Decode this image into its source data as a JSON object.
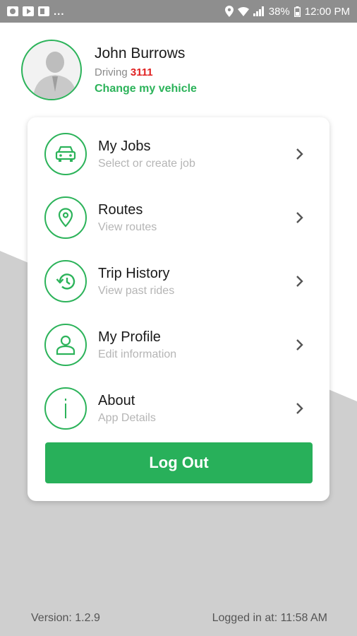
{
  "status_bar": {
    "left_icons": [
      "app-icon",
      "youtube-icon",
      "flipboard-icon"
    ],
    "dots": "...",
    "battery": "38%",
    "time": "12:00 PM"
  },
  "user": {
    "name": "John Burrows",
    "driving_label": "Driving",
    "vehicle_number": "3111",
    "change_vehicle": "Change my vehicle"
  },
  "menu": {
    "items": [
      {
        "title": "My Jobs",
        "subtitle": "Select or create job",
        "icon": "car-icon"
      },
      {
        "title": "Routes",
        "subtitle": "View routes",
        "icon": "location-pin-icon"
      },
      {
        "title": "Trip History",
        "subtitle": "View past rides",
        "icon": "history-icon"
      },
      {
        "title": "My Profile",
        "subtitle": "Edit information",
        "icon": "person-icon"
      },
      {
        "title": "About",
        "subtitle": "App Details",
        "icon": "info-icon"
      }
    ],
    "logout_label": "Log Out"
  },
  "footer": {
    "version": "Version: 1.2.9",
    "logged_in": "Logged in at: 11:58 AM"
  },
  "colors": {
    "accent": "#2cb35a",
    "button": "#28b05a",
    "vehicle_number": "#e02020",
    "status_bar": "#8e8e8e",
    "background_shape": "#cfcfcf"
  }
}
